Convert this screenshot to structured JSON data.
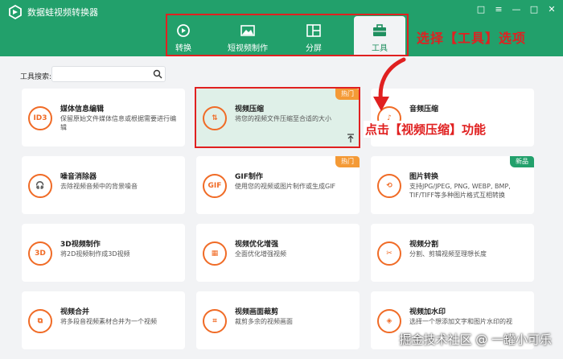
{
  "app": {
    "title": "数据蛙视频转换器"
  },
  "window": {
    "controls": [
      "□",
      "≡",
      "—",
      "□",
      "✕"
    ]
  },
  "tabs": [
    {
      "label": "转换",
      "icon": "refresh-icon",
      "active": false
    },
    {
      "label": "短视频制作",
      "icon": "image-icon",
      "active": false
    },
    {
      "label": "分屏",
      "icon": "split-screen-icon",
      "active": false
    },
    {
      "label": "工具",
      "icon": "toolbox-icon",
      "active": true
    }
  ],
  "callouts": {
    "top": "选择【工具】选项",
    "middle": "点击【视频压缩】功能"
  },
  "search": {
    "label": "工具搜索:",
    "placeholder": ""
  },
  "tools": [
    {
      "title": "媒体信息编辑",
      "desc": "保留原始文件媒体信息或根据需要进行编辑",
      "icon_text": "ID3",
      "badge": ""
    },
    {
      "title": "视频压缩",
      "desc": "将您的视频文件压缩至合适的大小",
      "icon_text": "⇅",
      "badge": "热门"
    },
    {
      "title": "音频压缩",
      "desc": "",
      "icon_text": "♪",
      "badge": ""
    },
    {
      "title": "噪音消除器",
      "desc": "去除视频音频中的背景噪音",
      "icon_text": "🎧",
      "badge": ""
    },
    {
      "title": "GIF制作",
      "desc": "使用您的视频或图片制作或生成GIF",
      "icon_text": "GIF",
      "badge": "热门"
    },
    {
      "title": "图片转换",
      "desc": "支持JPG/JPEG, PNG, WEBP, BMP, TIF/TIFF等多种图片格式互相转换",
      "icon_text": "⟲",
      "badge": "新品"
    },
    {
      "title": "3D视频制作",
      "desc": "将2D视频制作成3D视频",
      "icon_text": "3D",
      "badge": ""
    },
    {
      "title": "视频优化增强",
      "desc": "全面优化增强视频",
      "icon_text": "▦",
      "badge": ""
    },
    {
      "title": "视频分割",
      "desc": "分割、剪辑视频至理想长度",
      "icon_text": "✂",
      "badge": ""
    },
    {
      "title": "视频合并",
      "desc": "将多段音视频素材合并为一个视频",
      "icon_text": "⧉",
      "badge": ""
    },
    {
      "title": "视频画面裁剪",
      "desc": "裁剪多余的视频画面",
      "icon_text": "⌗",
      "badge": ""
    },
    {
      "title": "视频加水印",
      "desc": "选择一个想添加文字和图片水印的视",
      "icon_text": "◈",
      "badge": ""
    }
  ],
  "watermark": "掘金技术社区 @ 一罐小可乐",
  "colors": {
    "brand": "#22a06b",
    "accent": "#f06b26",
    "hot": "#f49a36",
    "annotation": "#e02020"
  }
}
